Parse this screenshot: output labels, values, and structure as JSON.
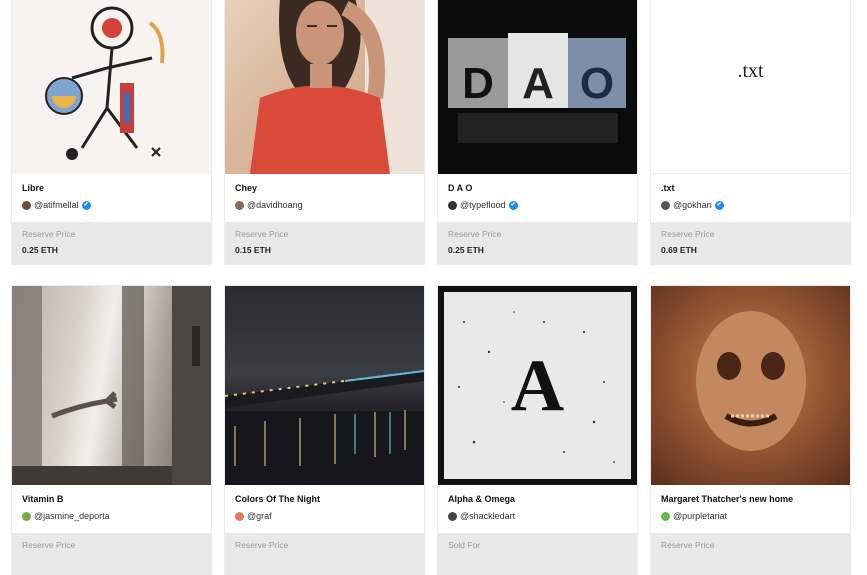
{
  "cards": [
    {
      "title": "Libre",
      "creator": "@atifmellal",
      "verified": true,
      "price_label": "Reserve Price",
      "price": "0.25 ETH",
      "avatar_color": "#6b4f3a"
    },
    {
      "title": "Chey",
      "creator": "@davidhoang",
      "verified": false,
      "price_label": "Reserve Price",
      "price": "0.15 ETH",
      "avatar_color": "#8a6a5a"
    },
    {
      "title": "D A O",
      "creator": "@typeflood",
      "verified": true,
      "price_label": "Reserve Price",
      "price": "0.25 ETH",
      "avatar_color": "#333333",
      "art_text": "DAO"
    },
    {
      "title": ".txt",
      "creator": "@gokhan",
      "verified": true,
      "price_label": "Reserve Price",
      "price": "0.69 ETH",
      "avatar_color": "#555555",
      "art_text": ".txt"
    },
    {
      "title": "Vitamin B",
      "creator": "@jasmine_deporta",
      "verified": false,
      "price_label": "Reserve Price",
      "avatar_color": "#7aa64a"
    },
    {
      "title": "Colors Of The Night",
      "creator": "@graf",
      "verified": false,
      "price_label": "Reserve Price",
      "avatar_color": "#e2795a"
    },
    {
      "title": "Alpha & Omega",
      "creator": "@shackledart",
      "verified": false,
      "price_label": "Sold For",
      "avatar_color": "#444444",
      "art_text": "A"
    },
    {
      "title": "Margaret Thatcher's new home",
      "creator": "@purpletariat",
      "verified": false,
      "price_label": "Reserve Price",
      "avatar_color": "#68b84a"
    }
  ],
  "icons": {
    "verified": "✔"
  }
}
